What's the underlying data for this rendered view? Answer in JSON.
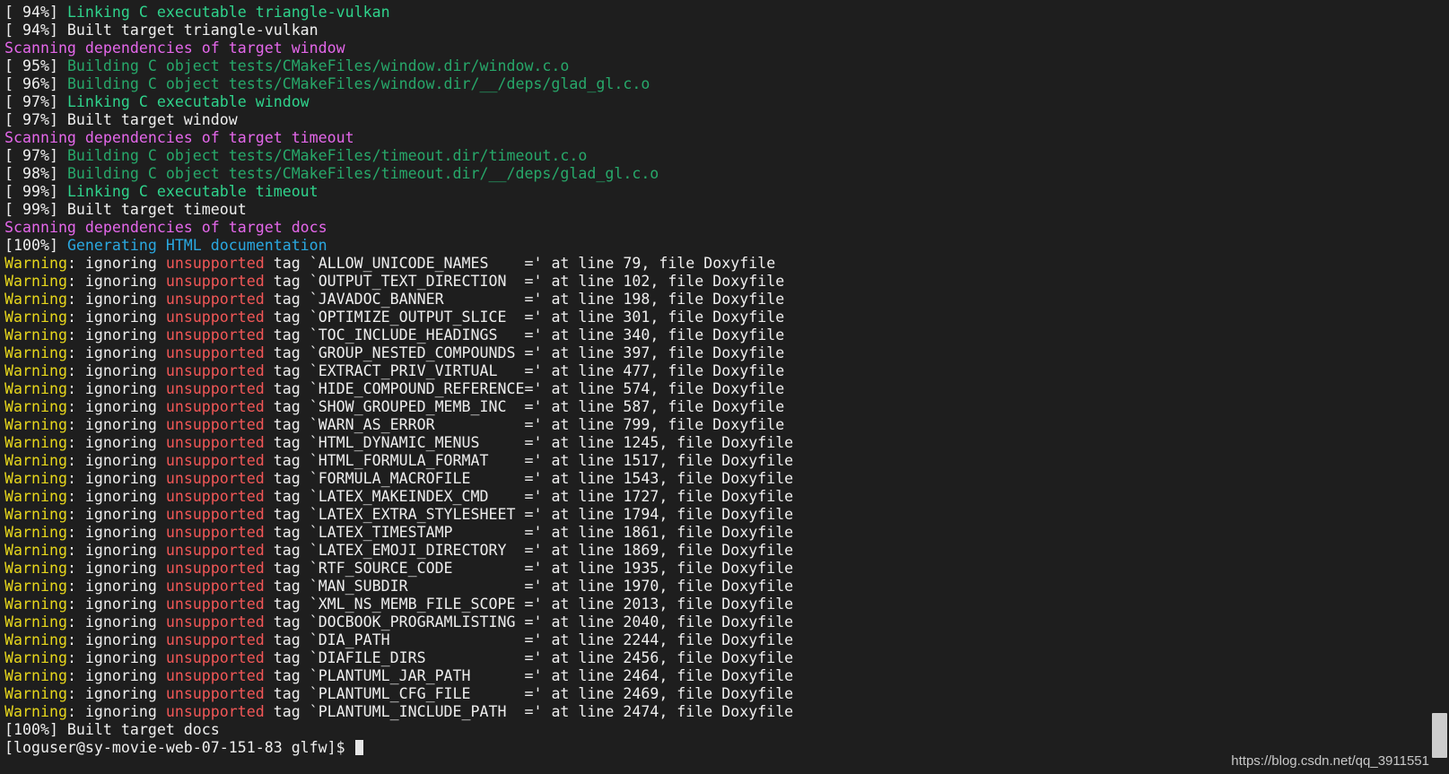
{
  "colors": {
    "background": "#1e1e1e",
    "text": "#eeeeee",
    "green": "#2fd38c",
    "dark_green": "#27a86a",
    "magenta": "#e467ea",
    "cyan": "#2aa8e0",
    "yellow": "#e6d61c",
    "red": "#f25757"
  },
  "terminal_lines": [
    [
      {
        "t": "[ 94%] ",
        "c": "white"
      },
      {
        "t": "Linking C executable triangle-vulkan",
        "c": "green"
      }
    ],
    [
      {
        "t": "[ 94%] Built target triangle-vulkan",
        "c": "white"
      }
    ],
    [
      {
        "t": "Scanning dependencies of target window",
        "c": "magenta"
      }
    ],
    [
      {
        "t": "[ 95%] ",
        "c": "white"
      },
      {
        "t": "Building C object tests/CMakeFiles/window.dir/window.c.o",
        "c": "dgreen"
      }
    ],
    [
      {
        "t": "[ 96%] ",
        "c": "white"
      },
      {
        "t": "Building C object tests/CMakeFiles/window.dir/__/deps/glad_gl.c.o",
        "c": "dgreen"
      }
    ],
    [
      {
        "t": "[ 97%] ",
        "c": "white"
      },
      {
        "t": "Linking C executable window",
        "c": "green"
      }
    ],
    [
      {
        "t": "[ 97%] Built target window",
        "c": "white"
      }
    ],
    [
      {
        "t": "Scanning dependencies of target timeout",
        "c": "magenta"
      }
    ],
    [
      {
        "t": "[ 97%] ",
        "c": "white"
      },
      {
        "t": "Building C object tests/CMakeFiles/timeout.dir/timeout.c.o",
        "c": "dgreen"
      }
    ],
    [
      {
        "t": "[ 98%] ",
        "c": "white"
      },
      {
        "t": "Building C object tests/CMakeFiles/timeout.dir/__/deps/glad_gl.c.o",
        "c": "dgreen"
      }
    ],
    [
      {
        "t": "[ 99%] ",
        "c": "white"
      },
      {
        "t": "Linking C executable timeout",
        "c": "green"
      }
    ],
    [
      {
        "t": "[ 99%] Built target timeout",
        "c": "white"
      }
    ],
    [
      {
        "t": "Scanning dependencies of target docs",
        "c": "magenta"
      }
    ],
    [
      {
        "t": "[100%] ",
        "c": "white"
      },
      {
        "t": "Generating HTML documentation",
        "c": "cyan"
      }
    ],
    [
      {
        "t": "Warning",
        "c": "yellow"
      },
      {
        "t": ": ignoring ",
        "c": "white"
      },
      {
        "t": "unsupported",
        "c": "red"
      },
      {
        "t": " tag `ALLOW_UNICODE_NAMES    =' at line 79, file Doxyfile",
        "c": "white"
      }
    ],
    [
      {
        "t": "Warning",
        "c": "yellow"
      },
      {
        "t": ": ignoring ",
        "c": "white"
      },
      {
        "t": "unsupported",
        "c": "red"
      },
      {
        "t": " tag `OUTPUT_TEXT_DIRECTION  =' at line 102, file Doxyfile",
        "c": "white"
      }
    ],
    [
      {
        "t": "Warning",
        "c": "yellow"
      },
      {
        "t": ": ignoring ",
        "c": "white"
      },
      {
        "t": "unsupported",
        "c": "red"
      },
      {
        "t": " tag `JAVADOC_BANNER         =' at line 198, file Doxyfile",
        "c": "white"
      }
    ],
    [
      {
        "t": "Warning",
        "c": "yellow"
      },
      {
        "t": ": ignoring ",
        "c": "white"
      },
      {
        "t": "unsupported",
        "c": "red"
      },
      {
        "t": " tag `OPTIMIZE_OUTPUT_SLICE  =' at line 301, file Doxyfile",
        "c": "white"
      }
    ],
    [
      {
        "t": "Warning",
        "c": "yellow"
      },
      {
        "t": ": ignoring ",
        "c": "white"
      },
      {
        "t": "unsupported",
        "c": "red"
      },
      {
        "t": " tag `TOC_INCLUDE_HEADINGS   =' at line 340, file Doxyfile",
        "c": "white"
      }
    ],
    [
      {
        "t": "Warning",
        "c": "yellow"
      },
      {
        "t": ": ignoring ",
        "c": "white"
      },
      {
        "t": "unsupported",
        "c": "red"
      },
      {
        "t": " tag `GROUP_NESTED_COMPOUNDS =' at line 397, file Doxyfile",
        "c": "white"
      }
    ],
    [
      {
        "t": "Warning",
        "c": "yellow"
      },
      {
        "t": ": ignoring ",
        "c": "white"
      },
      {
        "t": "unsupported",
        "c": "red"
      },
      {
        "t": " tag `EXTRACT_PRIV_VIRTUAL   =' at line 477, file Doxyfile",
        "c": "white"
      }
    ],
    [
      {
        "t": "Warning",
        "c": "yellow"
      },
      {
        "t": ": ignoring ",
        "c": "white"
      },
      {
        "t": "unsupported",
        "c": "red"
      },
      {
        "t": " tag `HIDE_COMPOUND_REFERENCE=' at line 574, file Doxyfile",
        "c": "white"
      }
    ],
    [
      {
        "t": "Warning",
        "c": "yellow"
      },
      {
        "t": ": ignoring ",
        "c": "white"
      },
      {
        "t": "unsupported",
        "c": "red"
      },
      {
        "t": " tag `SHOW_GROUPED_MEMB_INC  =' at line 587, file Doxyfile",
        "c": "white"
      }
    ],
    [
      {
        "t": "Warning",
        "c": "yellow"
      },
      {
        "t": ": ignoring ",
        "c": "white"
      },
      {
        "t": "unsupported",
        "c": "red"
      },
      {
        "t": " tag `WARN_AS_ERROR          =' at line 799, file Doxyfile",
        "c": "white"
      }
    ],
    [
      {
        "t": "Warning",
        "c": "yellow"
      },
      {
        "t": ": ignoring ",
        "c": "white"
      },
      {
        "t": "unsupported",
        "c": "red"
      },
      {
        "t": " tag `HTML_DYNAMIC_MENUS     =' at line 1245, file Doxyfile",
        "c": "white"
      }
    ],
    [
      {
        "t": "Warning",
        "c": "yellow"
      },
      {
        "t": ": ignoring ",
        "c": "white"
      },
      {
        "t": "unsupported",
        "c": "red"
      },
      {
        "t": " tag `HTML_FORMULA_FORMAT    =' at line 1517, file Doxyfile",
        "c": "white"
      }
    ],
    [
      {
        "t": "Warning",
        "c": "yellow"
      },
      {
        "t": ": ignoring ",
        "c": "white"
      },
      {
        "t": "unsupported",
        "c": "red"
      },
      {
        "t": " tag `FORMULA_MACROFILE      =' at line 1543, file Doxyfile",
        "c": "white"
      }
    ],
    [
      {
        "t": "Warning",
        "c": "yellow"
      },
      {
        "t": ": ignoring ",
        "c": "white"
      },
      {
        "t": "unsupported",
        "c": "red"
      },
      {
        "t": " tag `LATEX_MAKEINDEX_CMD    =' at line 1727, file Doxyfile",
        "c": "white"
      }
    ],
    [
      {
        "t": "Warning",
        "c": "yellow"
      },
      {
        "t": ": ignoring ",
        "c": "white"
      },
      {
        "t": "unsupported",
        "c": "red"
      },
      {
        "t": " tag `LATEX_EXTRA_STYLESHEET =' at line 1794, file Doxyfile",
        "c": "white"
      }
    ],
    [
      {
        "t": "Warning",
        "c": "yellow"
      },
      {
        "t": ": ignoring ",
        "c": "white"
      },
      {
        "t": "unsupported",
        "c": "red"
      },
      {
        "t": " tag `LATEX_TIMESTAMP        =' at line 1861, file Doxyfile",
        "c": "white"
      }
    ],
    [
      {
        "t": "Warning",
        "c": "yellow"
      },
      {
        "t": ": ignoring ",
        "c": "white"
      },
      {
        "t": "unsupported",
        "c": "red"
      },
      {
        "t": " tag `LATEX_EMOJI_DIRECTORY  =' at line 1869, file Doxyfile",
        "c": "white"
      }
    ],
    [
      {
        "t": "Warning",
        "c": "yellow"
      },
      {
        "t": ": ignoring ",
        "c": "white"
      },
      {
        "t": "unsupported",
        "c": "red"
      },
      {
        "t": " tag `RTF_SOURCE_CODE        =' at line 1935, file Doxyfile",
        "c": "white"
      }
    ],
    [
      {
        "t": "Warning",
        "c": "yellow"
      },
      {
        "t": ": ignoring ",
        "c": "white"
      },
      {
        "t": "unsupported",
        "c": "red"
      },
      {
        "t": " tag `MAN_SUBDIR             =' at line 1970, file Doxyfile",
        "c": "white"
      }
    ],
    [
      {
        "t": "Warning",
        "c": "yellow"
      },
      {
        "t": ": ignoring ",
        "c": "white"
      },
      {
        "t": "unsupported",
        "c": "red"
      },
      {
        "t": " tag `XML_NS_MEMB_FILE_SCOPE =' at line 2013, file Doxyfile",
        "c": "white"
      }
    ],
    [
      {
        "t": "Warning",
        "c": "yellow"
      },
      {
        "t": ": ignoring ",
        "c": "white"
      },
      {
        "t": "unsupported",
        "c": "red"
      },
      {
        "t": " tag `DOCBOOK_PROGRAMLISTING =' at line 2040, file Doxyfile",
        "c": "white"
      }
    ],
    [
      {
        "t": "Warning",
        "c": "yellow"
      },
      {
        "t": ": ignoring ",
        "c": "white"
      },
      {
        "t": "unsupported",
        "c": "red"
      },
      {
        "t": " tag `DIA_PATH               =' at line 2244, file Doxyfile",
        "c": "white"
      }
    ],
    [
      {
        "t": "Warning",
        "c": "yellow"
      },
      {
        "t": ": ignoring ",
        "c": "white"
      },
      {
        "t": "unsupported",
        "c": "red"
      },
      {
        "t": " tag `DIAFILE_DIRS           =' at line 2456, file Doxyfile",
        "c": "white"
      }
    ],
    [
      {
        "t": "Warning",
        "c": "yellow"
      },
      {
        "t": ": ignoring ",
        "c": "white"
      },
      {
        "t": "unsupported",
        "c": "red"
      },
      {
        "t": " tag `PLANTUML_JAR_PATH      =' at line 2464, file Doxyfile",
        "c": "white"
      }
    ],
    [
      {
        "t": "Warning",
        "c": "yellow"
      },
      {
        "t": ": ignoring ",
        "c": "white"
      },
      {
        "t": "unsupported",
        "c": "red"
      },
      {
        "t": " tag `PLANTUML_CFG_FILE      =' at line 2469, file Doxyfile",
        "c": "white"
      }
    ],
    [
      {
        "t": "Warning",
        "c": "yellow"
      },
      {
        "t": ": ignoring ",
        "c": "white"
      },
      {
        "t": "unsupported",
        "c": "red"
      },
      {
        "t": " tag `PLANTUML_INCLUDE_PATH  =' at line 2474, file Doxyfile",
        "c": "white"
      }
    ],
    [
      {
        "t": "[100%] Built target docs",
        "c": "white"
      }
    ]
  ],
  "prompt": "[loguser@sy-movie-web-07-151-83 glfw]$ ",
  "watermark": "https://blog.csdn.net/qq_3911551",
  "scroll_position_percent": 97
}
